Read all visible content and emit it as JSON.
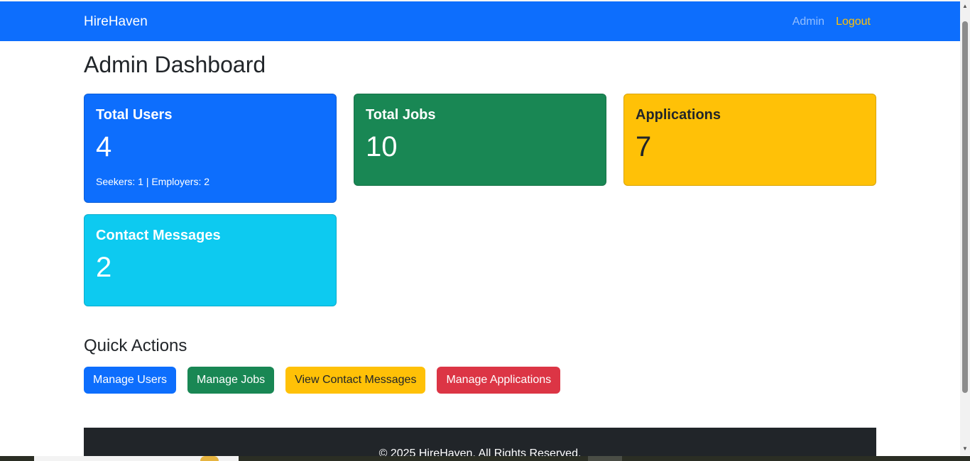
{
  "navbar": {
    "brand": "HireHaven",
    "links": {
      "admin": "Admin",
      "logout": "Logout"
    }
  },
  "page": {
    "title": "Admin Dashboard"
  },
  "stats": {
    "users": {
      "title": "Total Users",
      "value": "4",
      "sub": "Seekers: 1 | Employers: 2"
    },
    "jobs": {
      "title": "Total Jobs",
      "value": "10"
    },
    "applications": {
      "title": "Applications",
      "value": "7"
    },
    "messages": {
      "title": "Contact Messages",
      "value": "2"
    }
  },
  "quick_actions": {
    "title": "Quick Actions",
    "buttons": {
      "manage_users": "Manage Users",
      "manage_jobs": "Manage Jobs",
      "view_messages": "View Contact Messages",
      "manage_applications": "Manage Applications"
    }
  },
  "footer": {
    "text": "© 2025 HireHaven. All Rights Reserved."
  },
  "colors": {
    "primary": "#0d6efd",
    "success": "#198754",
    "warning": "#ffc107",
    "info": "#0dcaf0",
    "danger": "#dc3545",
    "dark": "#212529"
  },
  "icons": {
    "scroll_up": "scroll-up-arrow-icon",
    "scroll_down": "scroll-down-arrow-icon"
  }
}
